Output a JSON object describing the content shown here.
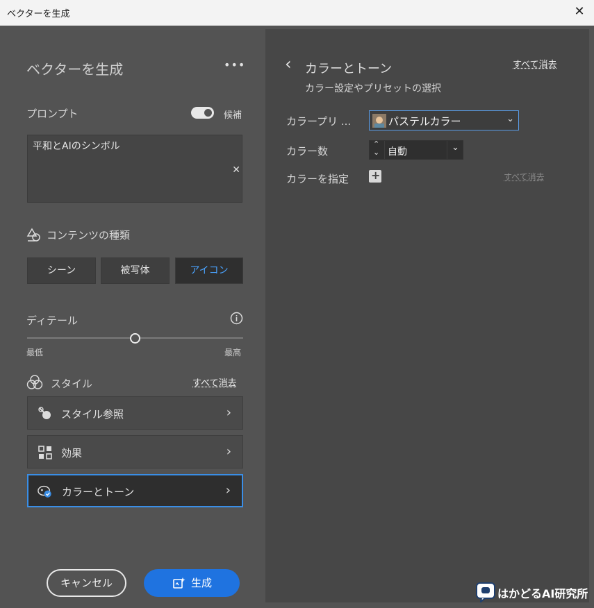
{
  "window": {
    "title": "ベクターを生成"
  },
  "panel": {
    "title": "ベクターを生成",
    "more": "•••"
  },
  "prompt": {
    "label": "プロンプト",
    "toggle_label": "候補",
    "value": "平和とAIのシンボル",
    "clear": "✕"
  },
  "content_type": {
    "label": "コンテンツの種類",
    "options": [
      "シーン",
      "被写体",
      "アイコン"
    ],
    "selected": "アイコン"
  },
  "detail": {
    "label": "ディテール",
    "min_label": "最低",
    "max_label": "最高",
    "value_fraction": 0.5
  },
  "style": {
    "label": "スタイル",
    "clear_all": "すべて消去",
    "items": [
      {
        "label": "スタイル参照"
      },
      {
        "label": "効果"
      },
      {
        "label": "カラーとトーン"
      }
    ]
  },
  "actions": {
    "cancel": "キャンセル",
    "generate": "生成"
  },
  "right": {
    "back": "‹",
    "title": "カラーとトーン",
    "subtitle": "カラー設定やプリセットの選択",
    "clear_all": "すべて消去",
    "preset_label": "カラープリ ...",
    "preset_value": "パステルカラー",
    "count_label": "カラー数",
    "count_value": "自動",
    "specify_label": "カラーを指定",
    "specify_clear": "すべて消去"
  },
  "watermark": "はかどるAI研究所",
  "colors": {
    "accent": "#1f73e0",
    "selection": "#3a8ee6",
    "active_text": "#4aa3ff"
  }
}
